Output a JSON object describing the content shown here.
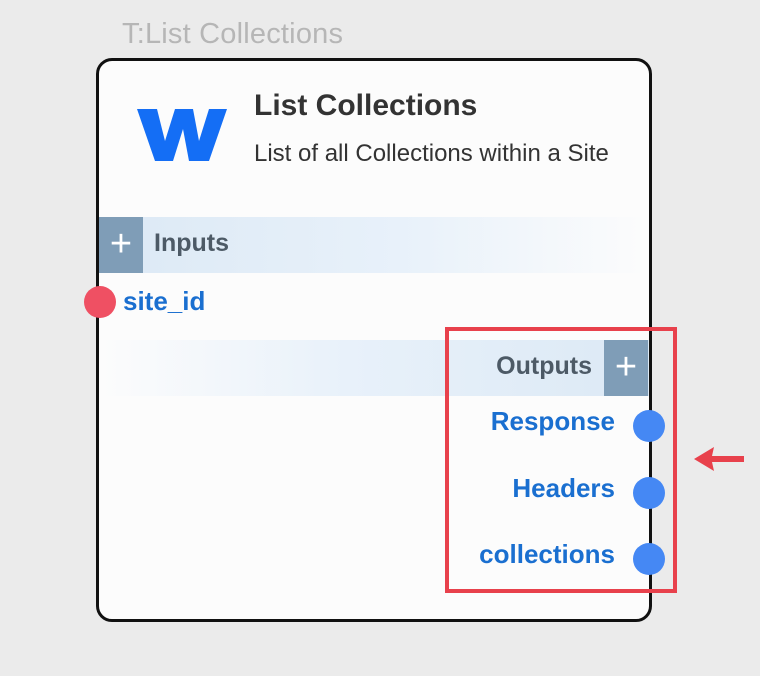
{
  "node": {
    "tag": "T:List Collections",
    "title": "List Collections",
    "description": "List of all Collections within a Site",
    "logo_icon": "webflow-logo-icon",
    "logo_color": "#146ef5"
  },
  "inputs": {
    "label": "Inputs",
    "add_label": "+",
    "ports": [
      {
        "label": "site_id",
        "color": "#ef5063"
      }
    ]
  },
  "outputs": {
    "label": "Outputs",
    "add_label": "+",
    "ports": [
      {
        "label": "Response",
        "color": "#4588f4"
      },
      {
        "label": "Headers",
        "color": "#4588f4"
      },
      {
        "label": "collections",
        "color": "#4588f4"
      }
    ]
  },
  "annotation": {
    "highlight_color": "#e8414c",
    "arrow_icon": "arrow-left-icon"
  }
}
